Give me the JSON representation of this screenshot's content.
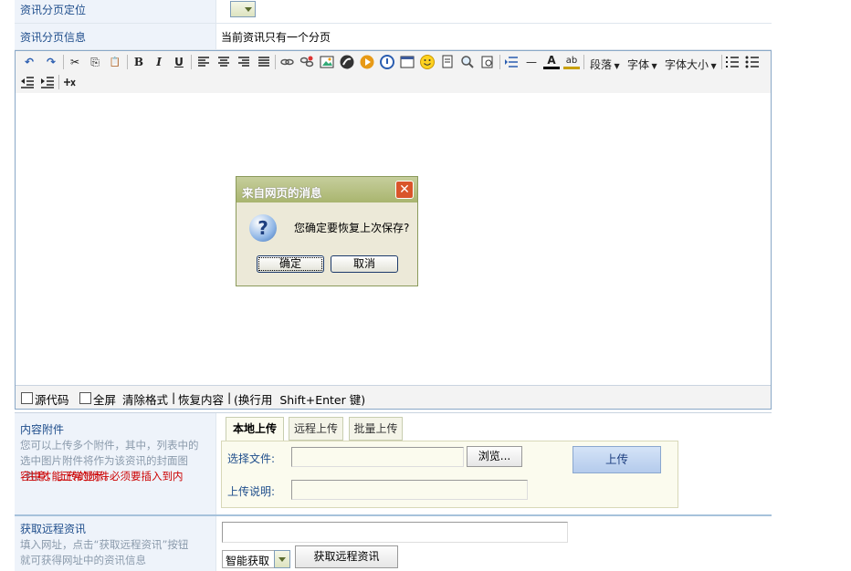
{
  "rows": {
    "page_position_label": "资讯分页定位",
    "page_info_label": "资讯分页信息",
    "page_info_value": "当前资讯只有一个分页"
  },
  "toolbar": {
    "undo": "↶",
    "redo": "↷",
    "cut": "✂",
    "copy": "⎘",
    "paste": "📋",
    "bold": "B",
    "italic": "I",
    "underline": "U",
    "paragraph_label": "段落",
    "font_label": "字体",
    "font_size_label": "字体大小",
    "hr": "—",
    "font_color": "A",
    "bg_color": "ab",
    "icons": [
      "align-left-icon",
      "align-center-icon",
      "align-right-icon",
      "align-justify-icon",
      "link-icon",
      "unlink-icon",
      "image-icon",
      "flash-icon",
      "media-icon",
      "special-char-icon",
      "table-icon",
      "emoticon-icon",
      "template-icon",
      "find-icon",
      "preview-icon",
      "insert-row-icon"
    ]
  },
  "editor_footer": {
    "source_label": "源代码",
    "fullscreen_label": "全屏",
    "clear_format": "清除格式",
    "separator": "|",
    "restore": "恢复内容",
    "newline_hint": "(换行用  Shift+Enter 键)"
  },
  "dialog": {
    "title": "来自网页的消息",
    "close": "✕",
    "icon": "?",
    "message": "您确定要恢复上次保存?",
    "ok": "确定",
    "cancel": "取消"
  },
  "attachments": {
    "title": "内容附件",
    "desc_line1": "您可以上传多个附件，其中，列表中的",
    "desc_line2": "选中图片附件将作为该资讯的封面图",
    "desc_line3_prefix": "片。",
    "desc_warning_1": "注意，上传的附件必须要插入到内",
    "desc_warning_2": "容中才能正常显示。",
    "tabs": [
      "本地上传",
      "远程上传",
      "批量上传"
    ],
    "file_label": "选择文件:",
    "browse": "浏览...",
    "desc_label": "上传说明:",
    "upload": "上传"
  },
  "remote": {
    "title": "获取远程资讯",
    "desc_line1": "填入网址，点击“获取远程资讯”按钮",
    "desc_line2": "就可获得网址中的资讯信息",
    "mode": "智能获取",
    "fetch": "获取远程资讯"
  }
}
